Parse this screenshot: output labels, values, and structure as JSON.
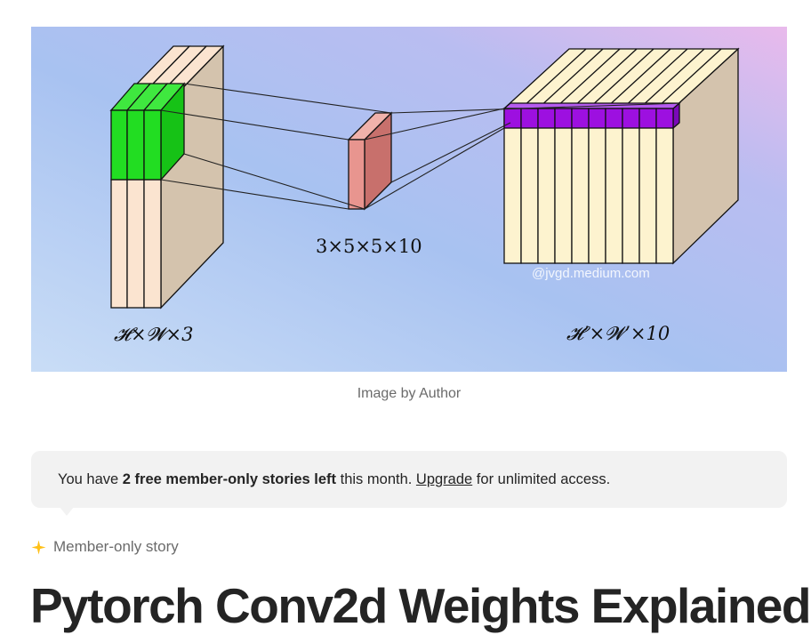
{
  "hero_image": {
    "left_label": "𝓗×𝓦×3",
    "middle_label": "3×5×5×10",
    "right_label": "𝓗’×𝓦’×10",
    "watermark": "@jvgd.medium.com",
    "colors": {
      "input_block": "#fbe4d0",
      "input_highlight": "#22dd22",
      "kernel": "#e8958f",
      "output_block": "#fdf3cf",
      "output_highlight": "#9d10e0",
      "side_face": "#d4c3ad"
    }
  },
  "caption": "Image by Author",
  "paywall_banner": {
    "prefix": "You have ",
    "highlight": "2 free member-only stories left",
    "middle": " this month. ",
    "link": "Upgrade",
    "suffix": " for unlimited access."
  },
  "member_badge": {
    "icon": "star-icon",
    "label": "Member-only story",
    "icon_color": "#ffc017"
  },
  "article": {
    "title": "Pytorch Conv2d Weights Explained"
  }
}
